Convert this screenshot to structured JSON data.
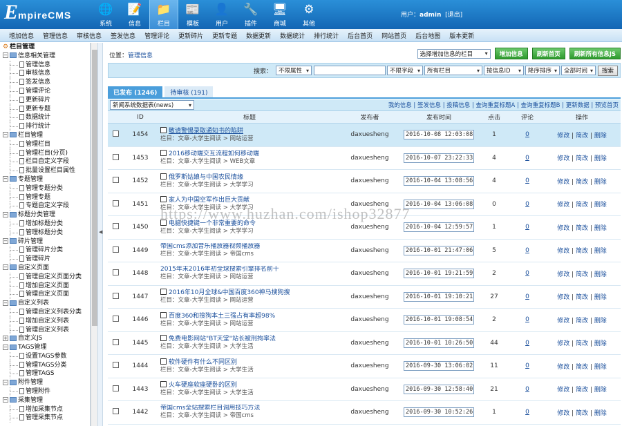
{
  "header": {
    "logo": {
      "initial": "E",
      "rest": "mpireCMS"
    },
    "nav": [
      {
        "label": "系统",
        "icon": "globe-icon",
        "glyph": "🌐",
        "active": false
      },
      {
        "label": "信息",
        "icon": "edit-icon",
        "glyph": "📝",
        "active": false
      },
      {
        "label": "栏目",
        "icon": "folder-icon",
        "glyph": "📁",
        "active": true
      },
      {
        "label": "模板",
        "icon": "template-icon",
        "glyph": "📰",
        "active": false
      },
      {
        "label": "用户",
        "icon": "user-icon",
        "glyph": "👤",
        "active": false
      },
      {
        "label": "插件",
        "icon": "tools-icon",
        "glyph": "🔧",
        "active": false
      },
      {
        "label": "商城",
        "icon": "shop-icon",
        "glyph": "🖥",
        "active": false
      },
      {
        "label": "其他",
        "icon": "gear-icon",
        "glyph": "⚙",
        "active": false
      }
    ],
    "user_label": "用户：",
    "user_name": "admin",
    "logout": "[退出]"
  },
  "subnav": [
    "增加信息",
    "管理信息",
    "审核信息",
    "签发信息",
    "管理评论",
    "更新碎片",
    "更新专题",
    "数据更新",
    "数据统计",
    "排行统计",
    "后台首页",
    "网站首页",
    "后台地图",
    "版本更新"
  ],
  "tree": [
    {
      "type": "root",
      "label": "栏目管理",
      "icon": "gear"
    },
    {
      "type": "group",
      "label": "信息相关管理"
    },
    {
      "type": "child",
      "label": "管理信息"
    },
    {
      "type": "child",
      "label": "审核信息"
    },
    {
      "type": "child",
      "label": "签发信息"
    },
    {
      "type": "child",
      "label": "管理评论"
    },
    {
      "type": "child",
      "label": "更新碎片"
    },
    {
      "type": "child",
      "label": "更新专题"
    },
    {
      "type": "child",
      "label": "数据统计"
    },
    {
      "type": "child",
      "label": "排行统计"
    },
    {
      "type": "group",
      "label": "栏目管理"
    },
    {
      "type": "child",
      "label": "管理栏目"
    },
    {
      "type": "child",
      "label": "管理栏目(分页)"
    },
    {
      "type": "child",
      "label": "栏目自定义字段"
    },
    {
      "type": "child",
      "label": "批量设置栏目属性"
    },
    {
      "type": "group",
      "label": "专题管理"
    },
    {
      "type": "child",
      "label": "管理专题分类"
    },
    {
      "type": "child",
      "label": "管理专题"
    },
    {
      "type": "child",
      "label": "专题自定义字段"
    },
    {
      "type": "group",
      "label": "标题分类管理"
    },
    {
      "type": "child",
      "label": "增加标题分类"
    },
    {
      "type": "child",
      "label": "管理标题分类"
    },
    {
      "type": "group",
      "label": "碎片管理"
    },
    {
      "type": "child",
      "label": "管理碎片分类"
    },
    {
      "type": "child",
      "label": "管理碎片"
    },
    {
      "type": "group",
      "label": "自定义页面"
    },
    {
      "type": "child",
      "label": "管理自定义页面分类"
    },
    {
      "type": "child",
      "label": "增加自定义页面"
    },
    {
      "type": "child",
      "label": "管理自定义页面"
    },
    {
      "type": "group",
      "label": "自定义列表"
    },
    {
      "type": "child",
      "label": "管理自定义列表分类"
    },
    {
      "type": "child",
      "label": "增加自定义列表"
    },
    {
      "type": "child",
      "label": "管理自定义列表"
    },
    {
      "type": "group",
      "label": "自定义JS",
      "collapsed": true
    },
    {
      "type": "group",
      "label": "TAGS管理"
    },
    {
      "type": "child",
      "label": "设置TAGS参数"
    },
    {
      "type": "child",
      "label": "管理TAGS分类"
    },
    {
      "type": "child",
      "label": "管理TAGS"
    },
    {
      "type": "group",
      "label": "附件管理"
    },
    {
      "type": "child",
      "label": "管理附件"
    },
    {
      "type": "group",
      "label": "采集管理"
    },
    {
      "type": "child",
      "label": "增加采集节点"
    },
    {
      "type": "child",
      "label": "管理采集节点"
    }
  ],
  "main": {
    "location_label": "位置：",
    "location_link": "管理信息",
    "column_select": "选择增加信息的栏目",
    "btn_add": "增加信息",
    "btn_refresh_home": "刷新首页",
    "btn_refresh_js": "刷新所有信息JS",
    "search": {
      "label": "搜索：",
      "attr": "不限属性",
      "keyword": "",
      "field": "不限字段",
      "column": "所有栏目",
      "order_by": "按信息ID",
      "order": "降序排序",
      "time": "全部时间",
      "button": "搜索"
    },
    "tabs": [
      {
        "label": "已发布 (1246)",
        "active": true
      },
      {
        "label": "待审核 (191)",
        "active": false
      }
    ],
    "table_select": "新闻系统数据表(news)",
    "toplinks": "我的信息 | 签发信息 | 投稿信息 | 查询重复标题A | 查询重复标题B | 更新数据 | 预览首页",
    "columns": [
      "",
      "ID",
      "标题",
      "发布者",
      "发布时间",
      "点击",
      "评论",
      "操作"
    ],
    "ops": [
      "修改",
      "简改",
      "删除"
    ],
    "rows": [
      {
        "id": "1454",
        "title": "敬请警惕录取通知书的陷阱",
        "cat": "栏目：文章-大学生阅读 > 网站运营",
        "pub": "daxuesheng",
        "time": "2016-10-08 12:03:08",
        "clicks": "1",
        "comments": "0",
        "icon": true,
        "hl": true,
        "u": true
      },
      {
        "id": "1453",
        "title": "2016移动端交互流程如何移动端",
        "cat": "栏目：文章-大学生阅读 > WEB文章",
        "pub": "daxuesheng",
        "time": "2016-10-07 23:22:33",
        "clicks": "4",
        "comments": "0",
        "icon": true,
        "hl": false,
        "u": false
      },
      {
        "id": "1452",
        "title": "俄罗斯姑娘与中国农民情缘",
        "cat": "栏目：文章-大学生阅读 > 大学学习",
        "pub": "daxuesheng",
        "time": "2016-10-04 13:08:56",
        "clicks": "4",
        "comments": "0",
        "icon": true,
        "hl": false,
        "u": false
      },
      {
        "id": "1451",
        "title": "家人为中国空军作出巨大贡献",
        "cat": "栏目：文章-大学生阅读 > 大学学习",
        "pub": "daxuesheng",
        "time": "2016-10-04 13:06:08",
        "clicks": "0",
        "comments": "0",
        "icon": true,
        "hl": false,
        "u": false
      },
      {
        "id": "1450",
        "title": "电脑快捷键一个非常重要的命令",
        "cat": "栏目：文章-大学生阅读 > 大学学习",
        "pub": "daxuesheng",
        "time": "2016-10-04 12:59:57",
        "clicks": "1",
        "comments": "0",
        "icon": true,
        "hl": false,
        "u": false
      },
      {
        "id": "1449",
        "title": "帝国cms添加音乐播放器视频播放器",
        "cat": "栏目：文章-大学生阅读 > 帝国cms",
        "pub": "daxuesheng",
        "time": "2016-10-01 21:47:06",
        "clicks": "5",
        "comments": "0",
        "icon": false,
        "hl": false,
        "u": false
      },
      {
        "id": "1448",
        "title": "2015年末2016年初全球搜索引擎排名前十",
        "cat": "栏目：文章-大学生阅读 > 网站运营",
        "pub": "daxuesheng",
        "time": "2016-10-01 19:21:59",
        "clicks": "2",
        "comments": "0",
        "icon": false,
        "hl": false,
        "u": false
      },
      {
        "id": "1447",
        "title": "2016年10月全球&中国百度360神马搜狗搜",
        "cat": "栏目：文章-大学生阅读 > 网站运营",
        "pub": "daxuesheng",
        "time": "2016-10-01 19:10:21",
        "clicks": "27",
        "comments": "0",
        "icon": true,
        "hl": false,
        "u": false
      },
      {
        "id": "1446",
        "title": "百度360和搜狗本土三强占有率超98%",
        "cat": "栏目：文章-大学生阅读 > 网站运营",
        "pub": "daxuesheng",
        "time": "2016-10-01 19:08:54",
        "clicks": "2",
        "comments": "0",
        "icon": true,
        "hl": false,
        "u": false
      },
      {
        "id": "1445",
        "title": "免费电影网站\"BT天堂\"站长被刑拘率法",
        "cat": "栏目：文章-大学生阅读 > 大学生活",
        "pub": "daxuesheng",
        "time": "2016-10-01 10:26:50",
        "clicks": "44",
        "comments": "0",
        "icon": true,
        "hl": false,
        "u": false
      },
      {
        "id": "1444",
        "title": "软件硬件有什么不同区别",
        "cat": "栏目：文章-大学生阅读 > 大学生活",
        "pub": "daxuesheng",
        "time": "2016-09-30 13:06:02",
        "clicks": "11",
        "comments": "0",
        "icon": true,
        "hl": false,
        "u": false
      },
      {
        "id": "1443",
        "title": "火车硬座软座硬卧的区别",
        "cat": "栏目：文章-大学生阅读 > 大学生活",
        "pub": "daxuesheng",
        "time": "2016-09-30 12:58:40",
        "clicks": "21",
        "comments": "0",
        "icon": true,
        "hl": false,
        "u": false
      },
      {
        "id": "1442",
        "title": "帝国cms全站搜索栏目调用技巧方法",
        "cat": "栏目：文章-大学生阅读 > 帝国cms",
        "pub": "daxuesheng",
        "time": "2016-09-30 10:52:26",
        "clicks": "1",
        "comments": "0",
        "icon": false,
        "hl": false,
        "u": false
      }
    ]
  },
  "watermark": "https://www.huzhan.com/ishop32877"
}
